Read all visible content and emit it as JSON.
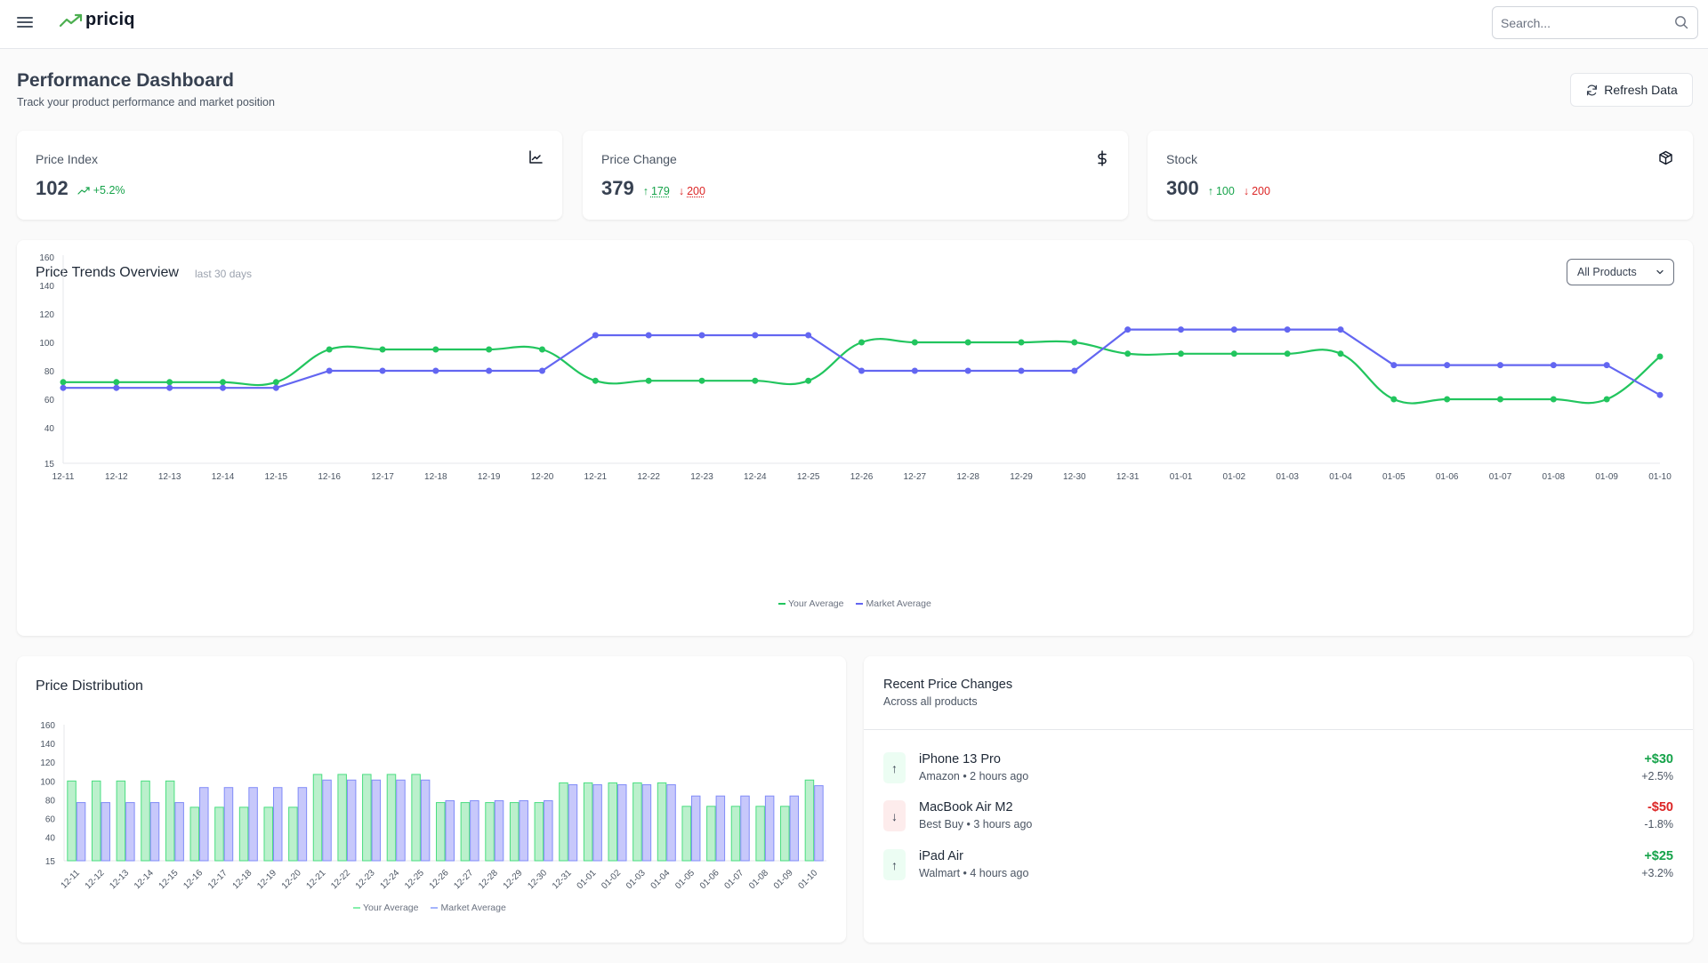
{
  "header": {
    "app_name": "priciq",
    "search_placeholder": "Search..."
  },
  "page": {
    "title": "Performance Dashboard",
    "subtitle": "Track your product performance and market position",
    "refresh_label": "Refresh Data"
  },
  "kpis": [
    {
      "label": "Price Index",
      "value": "102",
      "icon": "line-chart-icon",
      "trend": "+5.2%"
    },
    {
      "label": "Price Change",
      "value": "379",
      "icon": "dollar-icon",
      "up": "179",
      "down": "200"
    },
    {
      "label": "Stock",
      "value": "300",
      "icon": "package-icon",
      "up": "100",
      "down": "200"
    }
  ],
  "trends": {
    "title": "Price Trends Overview",
    "subtitle": "last 30 days",
    "filter_selected": "All Products"
  },
  "distribution": {
    "title": "Price Distribution"
  },
  "recent": {
    "title": "Recent Price Changes",
    "subtitle": "Across all products",
    "items": [
      {
        "name": "iPhone 13 Pro",
        "meta": "Amazon • 2 hours ago",
        "amount": "+$30",
        "pct": "+2.5%",
        "direction": "up"
      },
      {
        "name": "MacBook Air M2",
        "meta": "Best Buy • 3 hours ago",
        "amount": "-$50",
        "pct": "-1.8%",
        "direction": "down"
      },
      {
        "name": "iPad Air",
        "meta": "Walmart • 4 hours ago",
        "amount": "+$25",
        "pct": "+3.2%",
        "direction": "up"
      }
    ]
  },
  "colors": {
    "your_average": "#22c55e",
    "market_average": "#6366f1",
    "positive": "#16a34a",
    "negative": "#dc2626"
  },
  "chart_data": [
    {
      "type": "line",
      "title": "Price Trends Overview",
      "xlabel": "",
      "ylabel": "",
      "y_ticks": [
        15,
        40,
        60,
        80,
        100,
        120,
        140,
        160
      ],
      "ylim": [
        15,
        160
      ],
      "grid": false,
      "legend": "bottom-center",
      "x": [
        "12-11",
        "12-12",
        "12-13",
        "12-14",
        "12-15",
        "12-16",
        "12-17",
        "12-18",
        "12-19",
        "12-20",
        "12-21",
        "12-22",
        "12-23",
        "12-24",
        "12-25",
        "12-26",
        "12-27",
        "12-28",
        "12-29",
        "12-30",
        "12-31",
        "01-01",
        "01-02",
        "01-03",
        "01-04",
        "01-05",
        "01-06",
        "01-07",
        "01-08",
        "01-09",
        "01-10"
      ],
      "series": [
        {
          "name": "Your Average",
          "color": "#22c55e",
          "values": [
            72,
            72,
            72,
            72,
            72,
            95,
            95,
            95,
            95,
            95,
            73,
            73,
            73,
            73,
            73,
            100,
            100,
            100,
            100,
            100,
            92,
            92,
            92,
            92,
            92,
            60,
            60,
            60,
            60,
            60,
            90
          ]
        },
        {
          "name": "Market Average",
          "color": "#6366f1",
          "values": [
            68,
            68,
            68,
            68,
            68,
            80,
            80,
            80,
            80,
            80,
            105,
            105,
            105,
            105,
            105,
            80,
            80,
            80,
            80,
            80,
            109,
            109,
            109,
            109,
            109,
            84,
            84,
            84,
            84,
            84,
            63
          ]
        }
      ]
    },
    {
      "type": "bar",
      "title": "Price Distribution",
      "xlabel": "",
      "ylabel": "",
      "y_ticks": [
        15,
        40,
        60,
        80,
        100,
        120,
        140,
        160
      ],
      "ylim": [
        15,
        160
      ],
      "grid": false,
      "legend": "bottom-center",
      "categories": [
        "12-11",
        "12-12",
        "12-13",
        "12-14",
        "12-15",
        "12-16",
        "12-17",
        "12-18",
        "12-19",
        "12-20",
        "12-21",
        "12-22",
        "12-23",
        "12-24",
        "12-25",
        "12-26",
        "12-27",
        "12-28",
        "12-29",
        "12-30",
        "12-31",
        "01-01",
        "01-02",
        "01-03",
        "01-04",
        "01-05",
        "01-06",
        "01-07",
        "01-08",
        "01-09",
        "01-10"
      ],
      "series": [
        {
          "name": "Your Average",
          "color": "#22c55e",
          "values": [
            100,
            100,
            100,
            100,
            100,
            72,
            72,
            72,
            72,
            72,
            107,
            107,
            107,
            107,
            107,
            77,
            77,
            77,
            77,
            77,
            98,
            98,
            98,
            98,
            98,
            73,
            73,
            73,
            73,
            73,
            101
          ]
        },
        {
          "name": "Market Average",
          "color": "#6366f1",
          "values": [
            77,
            77,
            77,
            77,
            77,
            93,
            93,
            93,
            93,
            93,
            101,
            101,
            101,
            101,
            101,
            79,
            79,
            79,
            79,
            79,
            96,
            96,
            96,
            96,
            96,
            84,
            84,
            84,
            84,
            84,
            95
          ]
        }
      ]
    }
  ]
}
